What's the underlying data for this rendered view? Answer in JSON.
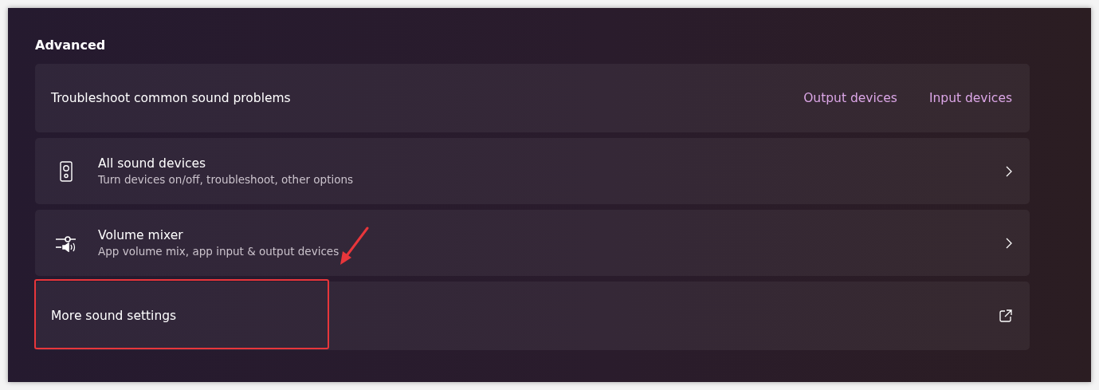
{
  "section_title": "Advanced",
  "items": [
    {
      "kind": "links",
      "title": "Troubleshoot common sound problems",
      "links": [
        "Output devices",
        "Input devices"
      ],
      "highlighted": false
    },
    {
      "kind": "devices",
      "title": "All sound devices",
      "subtitle": "Turn devices on/off, troubleshoot, other options",
      "highlighted": false
    },
    {
      "kind": "mixer",
      "title": "Volume mixer",
      "subtitle": "App volume mix, app input & output devices",
      "highlighted": false
    },
    {
      "kind": "external",
      "title": "More sound settings",
      "highlighted": true
    }
  ]
}
